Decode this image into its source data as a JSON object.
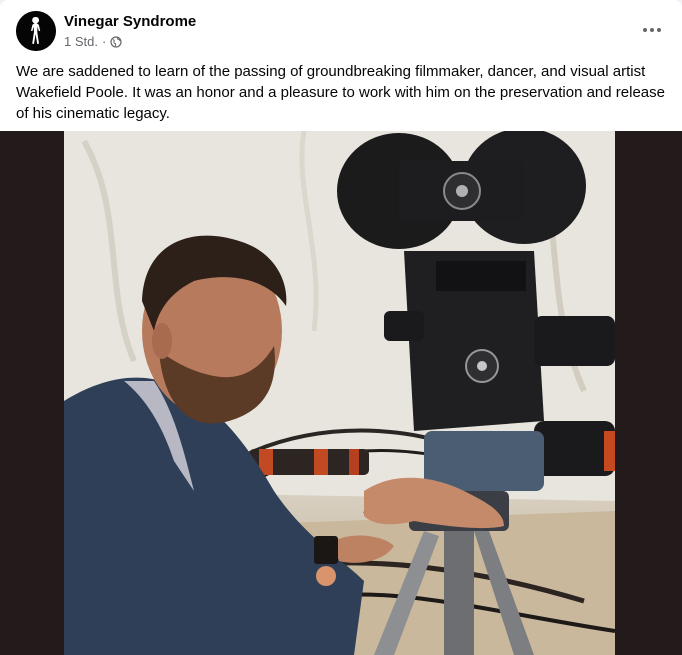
{
  "post": {
    "page_name": "Vinegar Syndrome",
    "timestamp": "1 Std.",
    "separator": "·",
    "audience_icon": "globe-icon",
    "more_icon": "more-horizontal-icon",
    "text": "We are saddened to learn of the passing of groundbreaking filmmaker, dancer, and visual artist Wakefield Poole. It was an honor and a pleasure to work with him on the preservation and release of his cinematic legacy."
  },
  "media": {
    "photo_subject": "man-with-film-camera-photo"
  },
  "colors": {
    "text_primary": "#050505",
    "text_secondary": "#65676b",
    "media_background": "#231b1b"
  }
}
